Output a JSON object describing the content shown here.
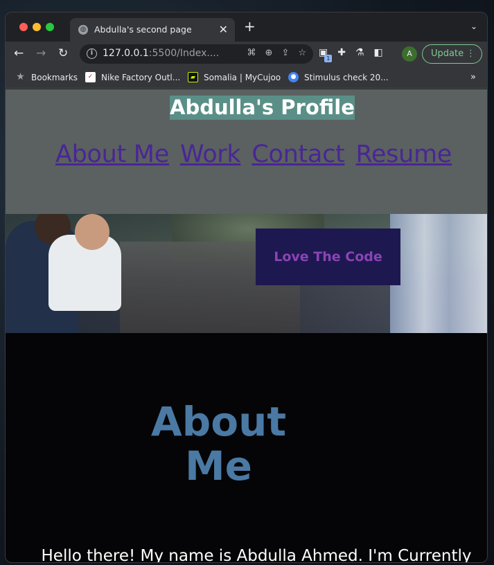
{
  "browser": {
    "tab": {
      "title": "Abdulla's second page",
      "close_glyph": "✕",
      "favicon": "globe-icon"
    },
    "new_tab_glyph": "+",
    "tab_menu_glyph": "⌄",
    "url_host": "127.0.0.1",
    "url_rest": ":5500/Index....",
    "toolbar": {
      "back_glyph": "←",
      "forward_glyph": "→",
      "reload_glyph": "↻",
      "update_label": "Update",
      "update_menu_glyph": "⋮",
      "avatar_letter": "A",
      "extension_badge": "1"
    },
    "bookmarks": [
      {
        "label": "Bookmarks",
        "icon": "star-icon"
      },
      {
        "label": "Nike Factory Outl...",
        "icon": "nike-icon"
      },
      {
        "label": "Somalia | MyCujoo",
        "icon": "mycujoo-icon"
      },
      {
        "label": "Stimulus check 20...",
        "icon": "stimulus-icon"
      }
    ],
    "bookmarks_more": "»"
  },
  "page": {
    "profile_title": "Abdulla's Profile",
    "nav": [
      "About Me",
      "Work",
      "Contact",
      "Resume"
    ],
    "hero_button": "Love The Code",
    "about_heading_line1": "About",
    "about_heading_line2": "Me",
    "about_text": "Hello there! My name is Abdulla Ahmed. I'm Currently preparing for a future that is full of code and am"
  },
  "colors": {
    "header_bg": "#5a6160",
    "title_bg": "#5a8f87",
    "nav_link": "#4a2597",
    "hero_button_bg": "#1e1850",
    "hero_button_text": "#8a44b5",
    "about_heading": "#4a79a4",
    "page_bg": "#050507"
  }
}
